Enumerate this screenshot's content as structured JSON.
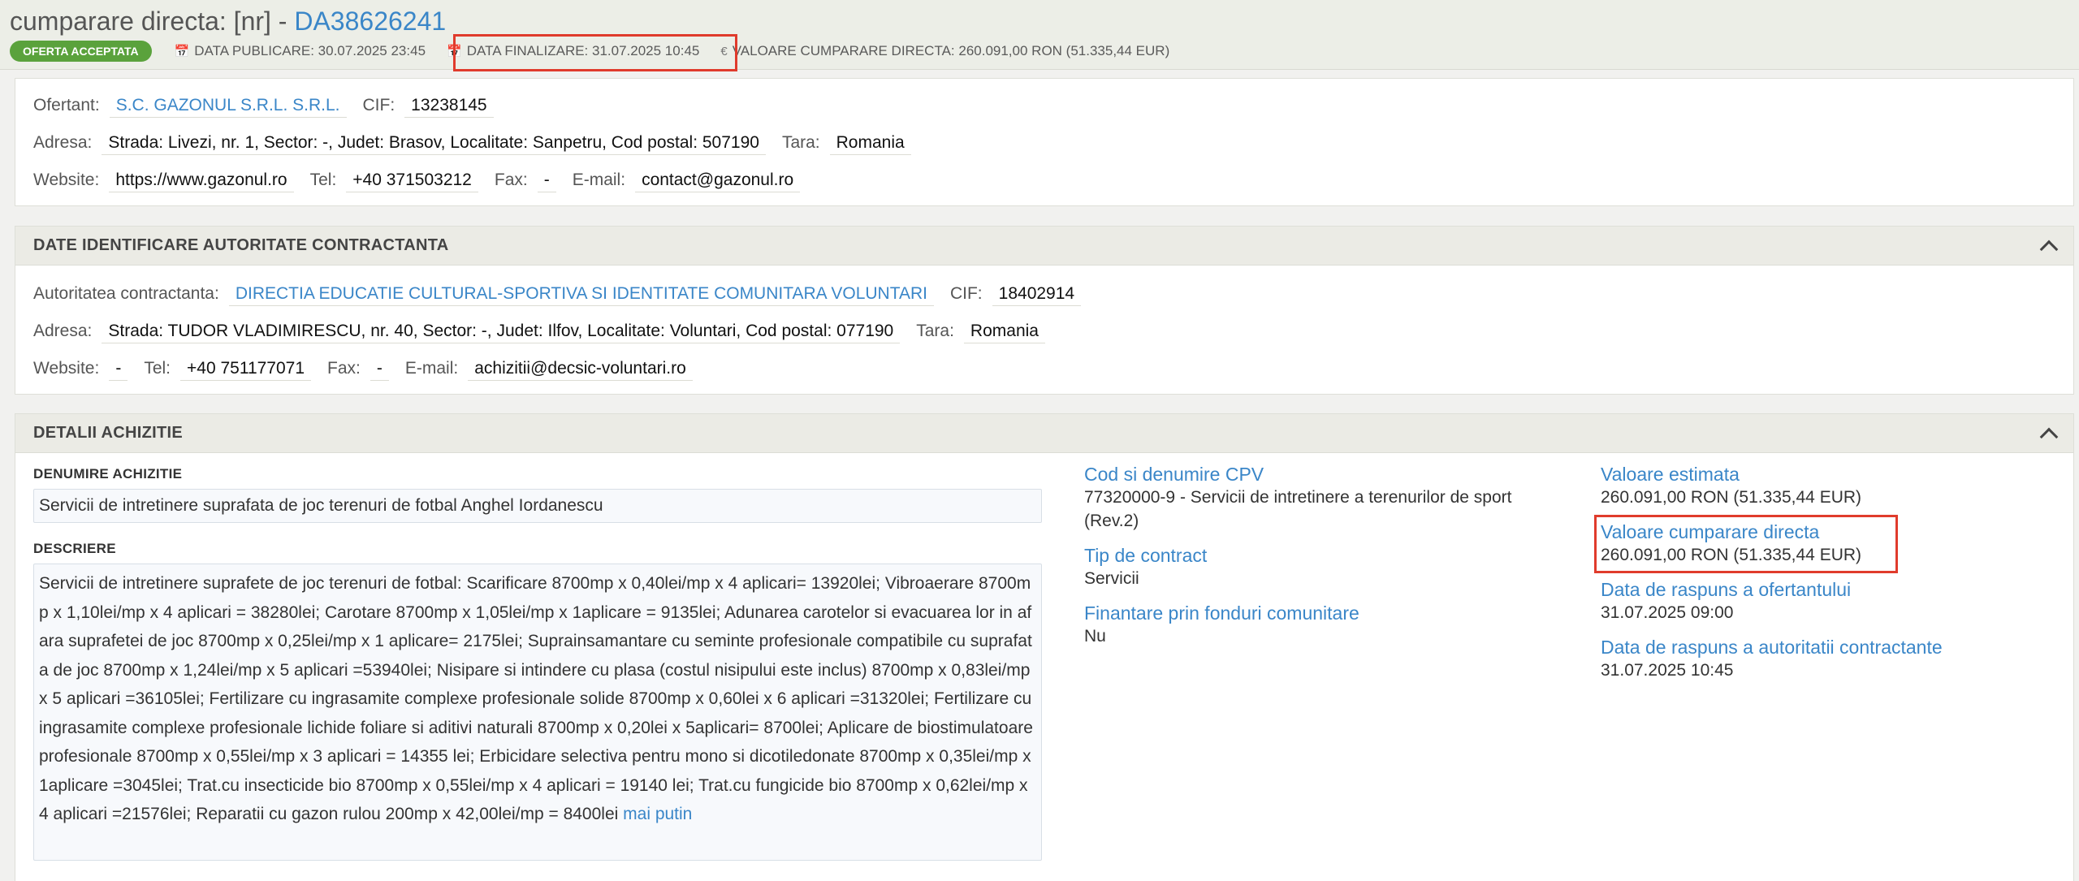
{
  "header": {
    "title_prefix": "cumparare directa: [nr] - ",
    "title_code": "DA38626241",
    "status_badge": "OFERTA ACCEPTATA",
    "data_publicare": "DATA PUBLICARE: 30.07.2025 23:45",
    "data_finalizare": "DATA FINALIZARE: 31.07.2025 10:45",
    "valoare": "VALOARE CUMPARARE DIRECTA: 260.091,00  RON (51.335,44  EUR)",
    "icons": {
      "calendar": "calendar-icon",
      "euro": "euro-icon"
    }
  },
  "ofertant": {
    "ofertant_label": "Ofertant:",
    "ofertant_value": "S.C. GAZONUL S.R.L. S.R.L.",
    "cif_label": "CIF:",
    "cif_value": "13238145",
    "adresa_label": "Adresa:",
    "adresa_value": "Strada: Livezi, nr. 1, Sector: -, Judet: Brasov, Localitate: Sanpetru, Cod postal: 507190",
    "tara_label": "Tara:",
    "tara_value": "Romania",
    "website_label": "Website:",
    "website_value": "https://www.gazonul.ro",
    "tel_label": "Tel:",
    "tel_value": "+40 371503212",
    "fax_label": "Fax:",
    "fax_value": "-",
    "email_label": "E-mail:",
    "email_value": "contact@gazonul.ro"
  },
  "autoritate": {
    "title": "DATE IDENTIFICARE AUTORITATE CONTRACTANTA",
    "autoritate_label": "Autoritatea contractanta:",
    "autoritate_value": "DIRECTIA EDUCATIE CULTURAL-SPORTIVA SI IDENTITATE COMUNITARA VOLUNTARI",
    "cif_label": "CIF:",
    "cif_value": "18402914",
    "adresa_label": "Adresa:",
    "adresa_value": "Strada: TUDOR VLADIMIRESCU, nr. 40, Sector: -, Judet: Ilfov, Localitate: Voluntari, Cod postal: 077190",
    "tara_label": "Tara:",
    "tara_value": "Romania",
    "website_label": "Website:",
    "website_value": "-",
    "tel_label": "Tel:",
    "tel_value": "+40 751177071",
    "fax_label": "Fax:",
    "fax_value": "-",
    "email_label": "E-mail:",
    "email_value": "achizitii@decsic-voluntari.ro"
  },
  "detalii": {
    "title": "DETALII ACHIZITIE",
    "denumire_label": "DENUMIRE ACHIZITIE",
    "denumire_value": "Servicii de intretinere suprafata de joc terenuri de fotbal Anghel Iordanescu",
    "descriere_label": "DESCRIERE",
    "descriere_value": "Servicii de intretinere suprafete de joc terenuri de fotbal: Scarificare 8700mp x 0,40lei/mp x 4 aplicari= 13920lei; Vibroaerare 8700mp x 1,10lei/mp x 4 aplicari = 38280lei; Carotare 8700mp x 1,05lei/mp x 1aplicare = 9135lei; Adunarea carotelor si evacuarea lor in afara suprafetei de joc 8700mp x 0,25lei/mp x 1 aplicare= 2175lei; Suprainsamantare cu seminte profesionale compatibile cu suprafata de joc 8700mp x 1,24lei/mp x 5 aplicari =53940lei; Nisipare si intindere cu plasa (costul nisipului este inclus) 8700mp x 0,83lei/mp x 5 aplicari =36105lei; Fertilizare cu ingrasamite complexe profesionale solide 8700mp x 0,60lei x 6 aplicari =31320lei; Fertilizare cu ingrasamite complexe profesionale lichide foliare si aditivi naturali 8700mp x 0,20lei x 5aplicari= 8700lei; Aplicare de biostimulatoare profesionale 8700mp x 0,55lei/mp x 3 aplicari = 14355 lei; Erbicidare selectiva pentru mono si dicotiledonate 8700mp x 0,35lei/mp x 1aplicare =3045lei; Trat.cu insecticide bio 8700mp x 0,55lei/mp x 4 aplicari = 19140 lei; Trat.cu fungicide bio 8700mp x 0,62lei/mp x 4 aplicari =21576lei; Reparatii cu gazon rulou 200mp x 42,00lei/mp = 8400lei",
    "mai_putin": "mai putin",
    "cpv_label": "Cod si denumire CPV",
    "cpv_value": "77320000-9 - Servicii de intretinere a terenurilor de sport (Rev.2)",
    "tip_label": "Tip de contract",
    "tip_value": "Servicii",
    "finantare_label": "Finantare prin fonduri comunitare",
    "finantare_value": "Nu",
    "estimata_label": "Valoare estimata",
    "estimata_value": "260.091,00  RON (51.335,44  EUR)",
    "cumparare_label": "Valoare cumparare directa",
    "cumparare_value": "260.091,00  RON (51.335,44  EUR)",
    "raspuns_ofertant_label": "Data de raspuns a ofertantului",
    "raspuns_ofertant_value": "31.07.2025 09:00",
    "raspuns_autoritate_label": "Data de raspuns a autoritatii contractante",
    "raspuns_autoritate_value": "31.07.2025 10:45"
  }
}
